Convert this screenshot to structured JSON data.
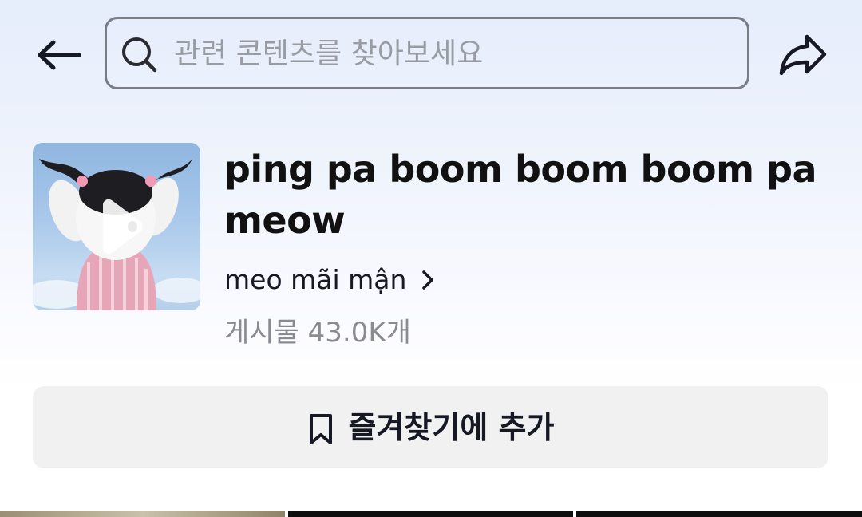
{
  "search": {
    "placeholder": "관련 콘텐츠를 찾아보세요"
  },
  "topic": {
    "title": "ping pa boom boom boom pa meow",
    "creator": "meo mãi mận",
    "post_count": "게시물 43.0K개"
  },
  "actions": {
    "favorite_label": "즐겨찾기에 추가"
  },
  "icons": {
    "back": "arrow-left-icon",
    "search": "search-icon",
    "share": "share-icon",
    "play": "play-icon",
    "chevron": "chevron-right-icon",
    "bookmark": "bookmark-icon"
  },
  "colors": {
    "background_top": "#e6edfb",
    "text_primary": "#161823",
    "text_secondary": "#8a8b91",
    "button_bg": "#f1f1f2"
  }
}
